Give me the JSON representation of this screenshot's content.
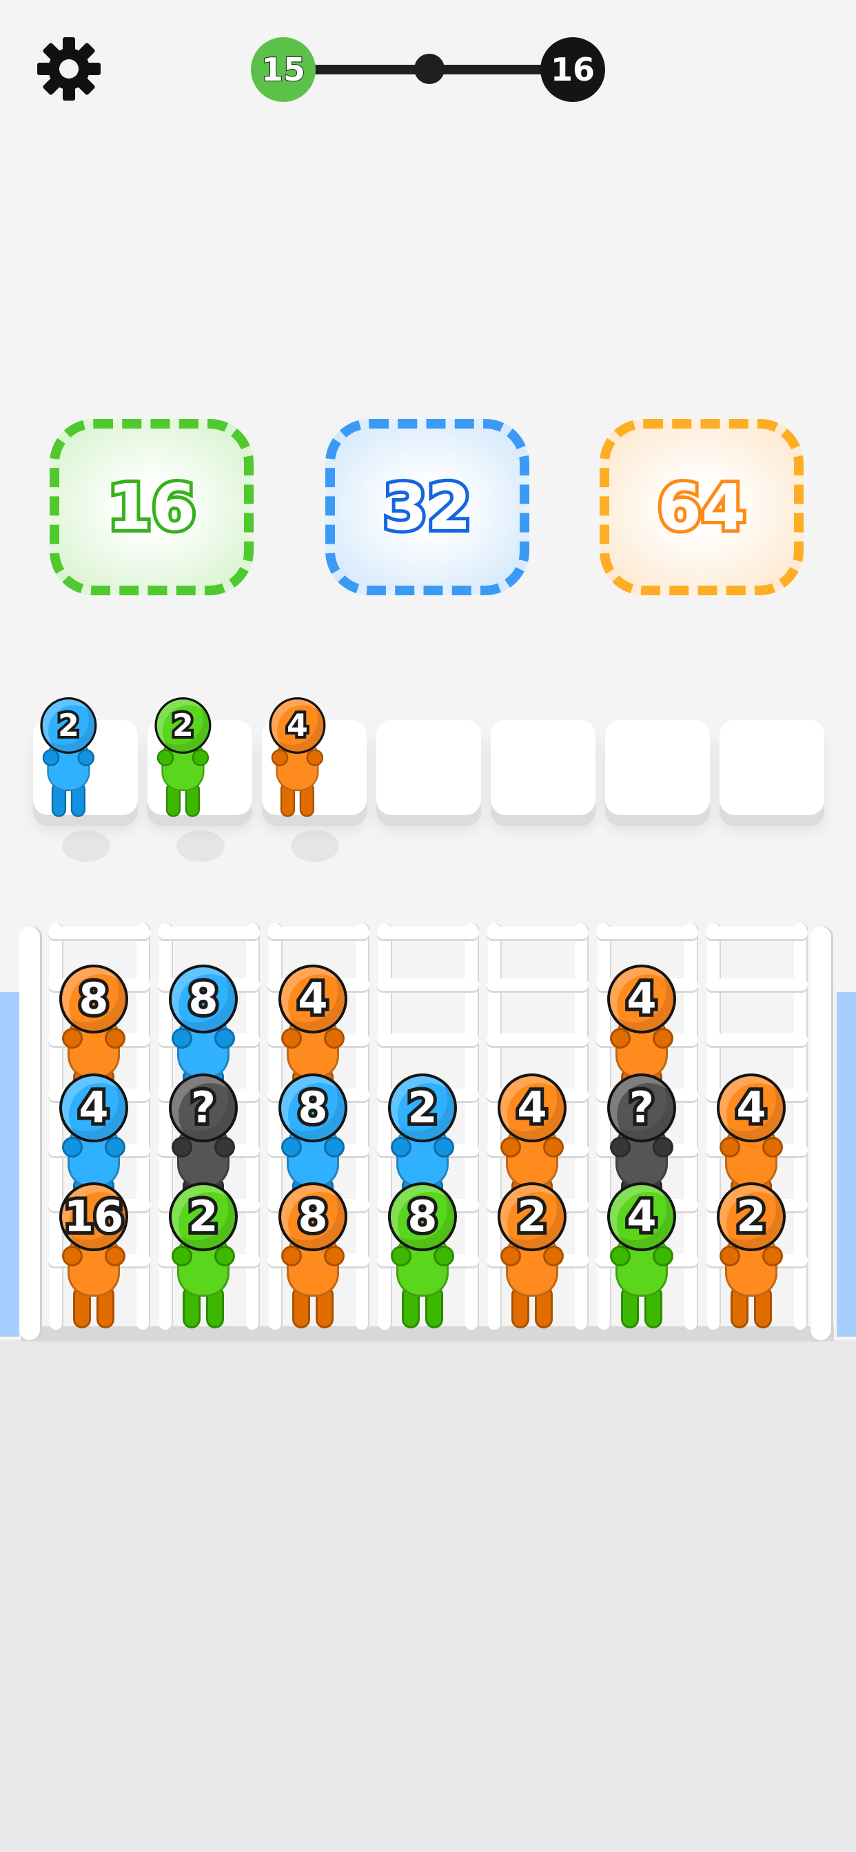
{
  "level": {
    "current": "15",
    "next": "16",
    "progress": 0.5
  },
  "targets": [
    {
      "label": "16",
      "color": "#4fc92e"
    },
    {
      "label": "32",
      "color": "#3b9af5"
    },
    {
      "label": "64",
      "color": "#ffad24"
    }
  ],
  "slots": {
    "count": 7,
    "filled": [
      {
        "label": "2",
        "color": "blue"
      },
      {
        "label": "2",
        "color": "green"
      },
      {
        "label": "4",
        "color": "orange"
      }
    ]
  },
  "columns": [
    [
      {
        "label": "8",
        "color": "orange"
      },
      {
        "label": "4",
        "color": "blue"
      },
      {
        "label": "16",
        "color": "orange"
      }
    ],
    [
      {
        "label": "8",
        "color": "blue"
      },
      {
        "label": "?",
        "color": "gray"
      },
      {
        "label": "2",
        "color": "green"
      }
    ],
    [
      {
        "label": "4",
        "color": "orange"
      },
      {
        "label": "8",
        "color": "blue"
      },
      {
        "label": "8",
        "color": "orange"
      }
    ],
    [
      {
        "label": "2",
        "color": "blue"
      },
      {
        "label": "8",
        "color": "green"
      }
    ],
    [
      {
        "label": "4",
        "color": "orange"
      },
      {
        "label": "2",
        "color": "orange"
      }
    ],
    [
      {
        "label": "4",
        "color": "orange"
      },
      {
        "label": "?",
        "color": "gray"
      },
      {
        "label": "4",
        "color": "green"
      }
    ],
    [
      {
        "label": "4",
        "color": "orange"
      },
      {
        "label": "2",
        "color": "orange"
      }
    ]
  ],
  "palette": {
    "orange": "#ff8a1e",
    "blue": "#2fb1ff",
    "green": "#5ad61c",
    "gray": "#555555"
  }
}
